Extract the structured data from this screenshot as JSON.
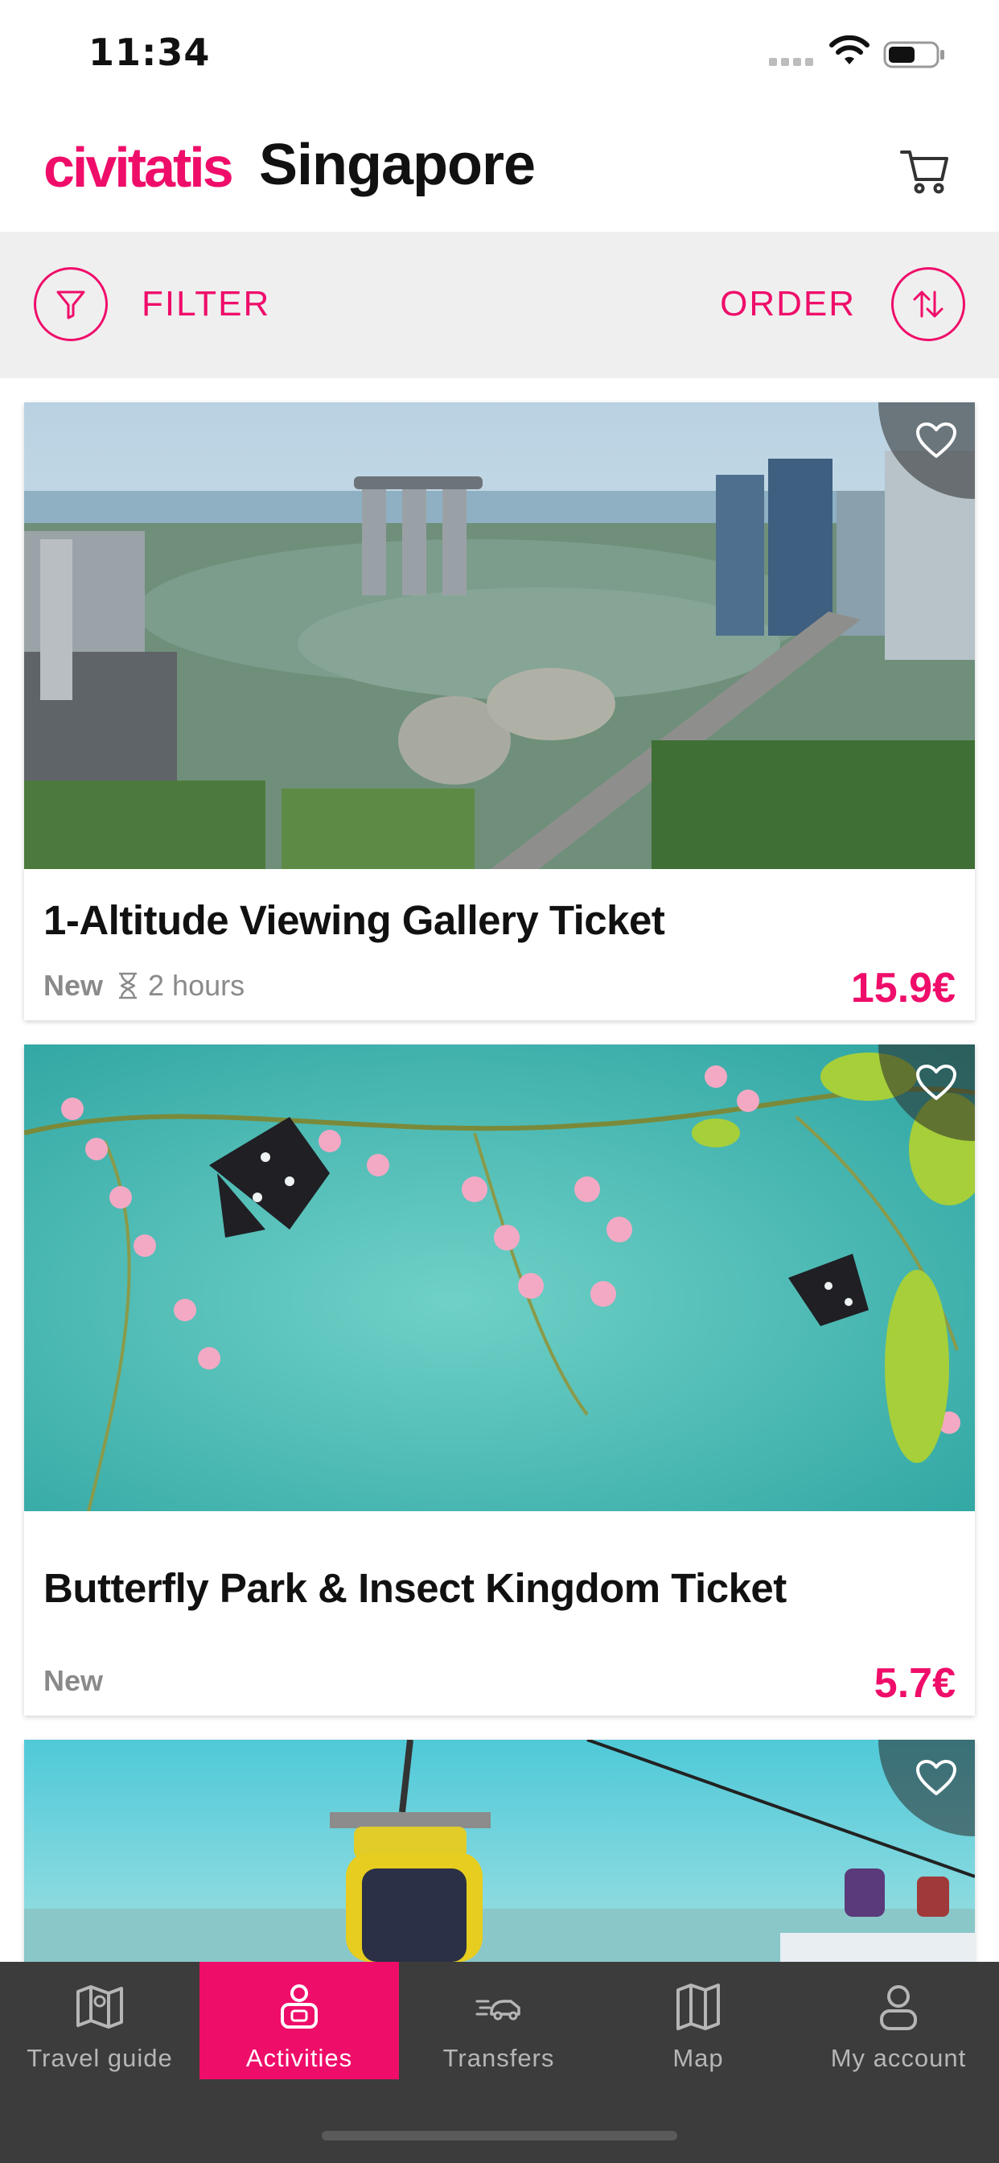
{
  "status_bar": {
    "time": "11:34"
  },
  "header": {
    "brand": "civitatis",
    "title": "Singapore"
  },
  "toolbar": {
    "filter_label": "FILTER",
    "order_label": "ORDER"
  },
  "colors": {
    "accent": "#ef0d6a",
    "nav_bg": "#3c3c3c",
    "filter_bg": "#efefef"
  },
  "activities": [
    {
      "title": "1-Altitude Viewing Gallery Ticket",
      "badge": "New",
      "duration": "2 hours",
      "price": "15.9€",
      "image": "marina-bay-skyline"
    },
    {
      "title": "Butterfly Park & Insect Kingdom Ticket",
      "badge": "New",
      "price": "5.7€",
      "image": "butterflies-pink-flowers"
    },
    {
      "image": "cable-car-over-sea"
    }
  ],
  "bottom_nav": {
    "items": [
      {
        "label": "Travel guide",
        "icon": "map-book-icon"
      },
      {
        "label": "Activities",
        "icon": "ticket-person-icon",
        "active": true
      },
      {
        "label": "Transfers",
        "icon": "car-transfer-icon"
      },
      {
        "label": "Map",
        "icon": "folded-map-icon"
      },
      {
        "label": "My account",
        "icon": "user-icon"
      }
    ]
  }
}
